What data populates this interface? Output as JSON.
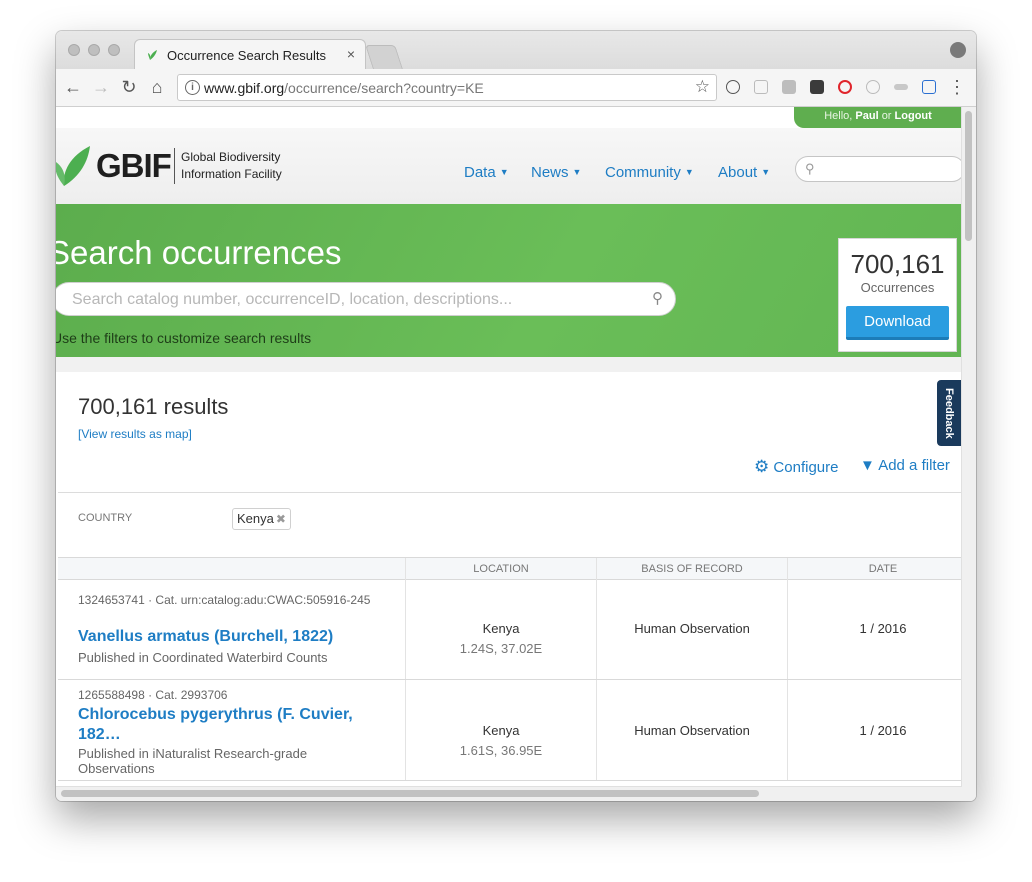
{
  "browser": {
    "tab_title": "Occurrence Search Results",
    "tab_close": "×",
    "url_host": "www.gbif.org",
    "url_path": "/occurrence/search?country=KE"
  },
  "user": {
    "greeting": "Hello,",
    "name": "Paul",
    "or": "or",
    "logout": "Logout"
  },
  "header": {
    "logo_text": "GBIF",
    "logo_sub_line1": "Global Biodiversity",
    "logo_sub_line2": "Information Facility",
    "nav": [
      {
        "label": "Data"
      },
      {
        "label": "News"
      },
      {
        "label": "Community"
      },
      {
        "label": "About"
      }
    ]
  },
  "hero": {
    "title": "Search occurrences",
    "search_placeholder": "Search catalog number, occurrenceID, location, descriptions...",
    "hint": "Use the filters to customize search results",
    "count": "700,161",
    "count_label": "Occurrences",
    "download_label": "Download"
  },
  "feedback_label": "Feedback",
  "results": {
    "title": "700,161 results",
    "map_link": "[View results as map]",
    "configure_label": "Configure",
    "add_filter_label": "Add a filter",
    "filter_label": "COUNTRY",
    "filter_value": "Kenya",
    "columns": [
      "LOCATION",
      "BASIS OF RECORD",
      "DATE"
    ],
    "rows": [
      {
        "meta": "1324653741 · Cat. urn:catalog:adu:CWAC:505916-245",
        "name": "Vanellus armatus (Burchell, 1822)",
        "published": "Published in Coordinated Waterbird Counts",
        "country": "Kenya",
        "coords": "1.24S, 37.02E",
        "basis": "Human Observation",
        "date": "1 / 2016"
      },
      {
        "meta": "1265588498 · Cat. 2993706",
        "name": "Chlorocebus pygerythrus (F. Cuvier, 182…",
        "published": "Published in iNaturalist Research-grade Observations",
        "country": "Kenya",
        "coords": "1.61S, 36.95E",
        "basis": "Human Observation",
        "date": "1 / 2016"
      }
    ]
  },
  "colors": {
    "brand_green": "#5fae4f",
    "link_blue": "#1e7dc4",
    "download_blue": "#2b9de0"
  },
  "icons": [
    "gbif-leaf-icon",
    "search-icon",
    "gear-icon",
    "filter-icon",
    "info-icon",
    "star-icon",
    "back-icon",
    "forward-icon",
    "reload-icon",
    "home-icon",
    "close-icon",
    "profile-icon",
    "menu-icon",
    "remove-icon"
  ]
}
